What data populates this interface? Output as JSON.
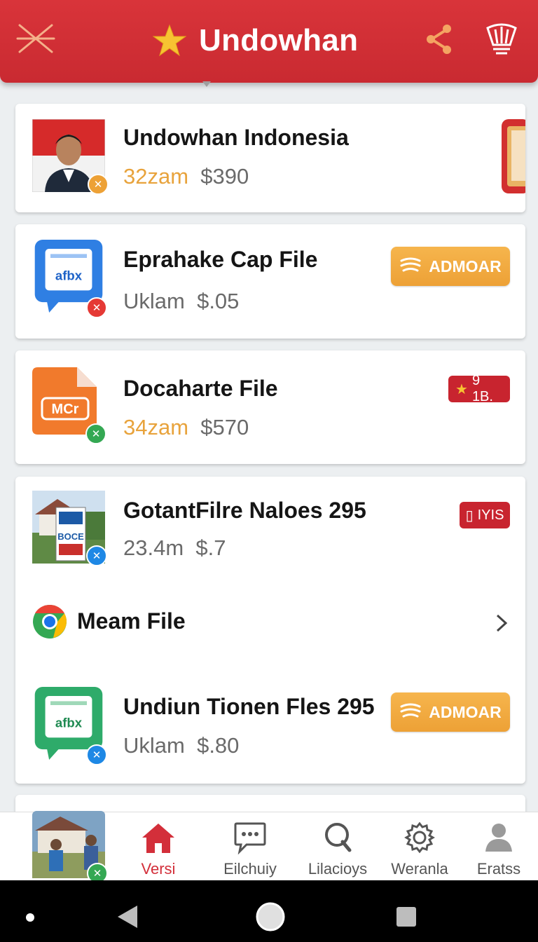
{
  "header": {
    "title": "Undowhan",
    "icons": {
      "menu": "sparkle-menu-icon",
      "logo": "star-icon",
      "share": "share-icon",
      "extra": "cup-icon"
    },
    "color": "#d32f3a"
  },
  "items": [
    {
      "title": "Undowhan Indonesia",
      "meta_time": "32zam",
      "meta_price": "$390",
      "thumb": "person-flag-photo",
      "badge": "tools-icon"
    },
    {
      "title": "Eprahake Cap File",
      "meta_time": "Uklam",
      "meta_price": "$.05",
      "thumb": "afbx-chat-icon",
      "thumb_text": "afbx",
      "badge": "pin-icon",
      "action": "ADMOAR"
    },
    {
      "title": "Docaharte File",
      "meta_time": "34zam",
      "meta_price": "$570",
      "thumb": "mcr-file-icon",
      "thumb_text": "MCr",
      "badge": "pin-icon",
      "tag": "9 1B."
    },
    {
      "title": "GotantFilre Naloes 295",
      "meta_time": "23.4m",
      "meta_price": "$.7",
      "thumb": "house-sign-photo",
      "thumb_text": "BOCE",
      "badge": "pin-icon",
      "tag": "IYIS"
    },
    {
      "title": "Meam File",
      "thumb": "chrome-icon"
    },
    {
      "title": "Undiun Tionen Fles 295",
      "meta_time": "Uklam",
      "meta_price": "$.80",
      "thumb": "afbx-chat-icon",
      "thumb_text": "afbx",
      "badge": "pin-icon",
      "action": "ADMOAR"
    }
  ],
  "nav": [
    {
      "label": "Versi",
      "icon": "home-icon",
      "active": true
    },
    {
      "label": "Eilchuiy",
      "icon": "chat-icon"
    },
    {
      "label": "Lilacioys",
      "icon": "search-icon"
    },
    {
      "label": "Weranla",
      "icon": "gear-icon"
    },
    {
      "label": "Eratss",
      "icon": "user-icon"
    }
  ],
  "colors": {
    "accent": "#d32f3a",
    "orange": "#eda136",
    "green": "#34a853",
    "blue": "#1e88e5"
  }
}
